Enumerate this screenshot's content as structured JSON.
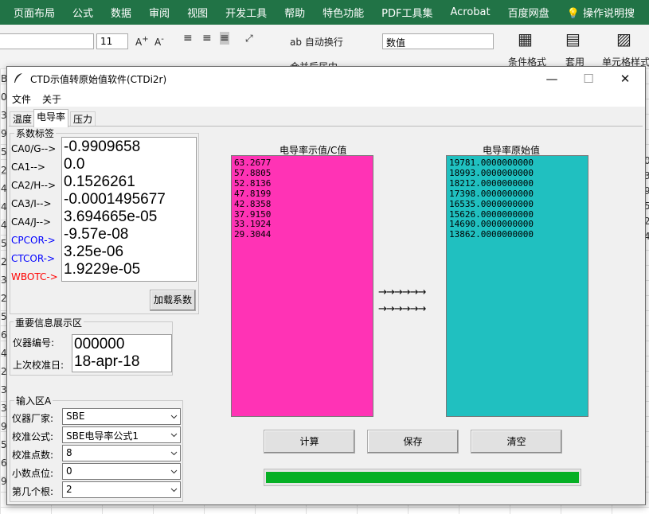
{
  "excel": {
    "menu": [
      "页面布局",
      "公式",
      "数据",
      "审阅",
      "视图",
      "开发工具",
      "帮助",
      "特色功能",
      "PDF工具集",
      "Acrobat",
      "百度网盘",
      "操作说明搜"
    ],
    "font_size": "11",
    "wrap_text": "自动换行",
    "number_format": "数值",
    "cond_format": "条件格式",
    "apply_table": "套用",
    "cell_style": "单元格样式",
    "merge_center": "合并后居中",
    "row_fragments": [
      "B",
      "0",
      "3",
      "9",
      "5",
      "2",
      "4",
      "4",
      "4",
      "5",
      "2",
      "3",
      "2",
      "5",
      "6",
      "4",
      "2",
      "3",
      "3",
      "9",
      "5",
      "6",
      "9"
    ],
    "right_fragments": [
      "0",
      "3",
      "9",
      "5",
      "2",
      "4"
    ]
  },
  "window": {
    "title": "CTD示值转原始值软件(CTDi2r)",
    "minimize": "—",
    "maximize": "☐",
    "close": "✕",
    "menu_file": "文件",
    "menu_about": "关于",
    "tabs": [
      "温度",
      "电导率",
      "压力"
    ]
  },
  "coef_group": {
    "title": "系数标签",
    "labels": [
      "CA0/G-->",
      "CA1-->",
      "CA2/H-->",
      "CA3/I-->",
      "CA4/J-->",
      "CPCOR->",
      "CTCOR->",
      "WBOTC->"
    ],
    "label_colors": [
      "#000000",
      "#000000",
      "#000000",
      "#000000",
      "#000000",
      "#0000ff",
      "#0000ff",
      "#ff0000"
    ],
    "values": [
      "-0.9909658",
      "0.0",
      "0.1526261",
      "-0.0001495677",
      "3.694665e-05",
      "-9.57e-08",
      "3.25e-06",
      "1.9229e-05"
    ],
    "load_button": "加载系数"
  },
  "info_group": {
    "title": "重要信息展示区",
    "serial_label": "仪器编号:",
    "serial_value": "000000",
    "calib_label": "上次校准日:",
    "calib_value": "18-apr-18"
  },
  "input_group": {
    "title": "输入区A",
    "fields": [
      {
        "label": "仪器厂家:",
        "value": "SBE"
      },
      {
        "label": "校准公式:",
        "value": "SBE电导率公式1"
      },
      {
        "label": "校准点数:",
        "value": "8"
      },
      {
        "label": "小数点位:",
        "value": "0"
      },
      {
        "label": "第几个根:",
        "value": "2"
      }
    ]
  },
  "left_panel": {
    "title": "电导率示值/C值",
    "color": "#ff33b5",
    "text": "63.2677\n57.8805\n52.8136\n47.8199\n42.8358\n37.9150\n33.1924\n29.3044"
  },
  "right_panel": {
    "title": "电导率原始值",
    "color": "#20c0c0",
    "text": "19781.0000000000\n18993.0000000000\n18212.0000000000\n17398.0000000000\n16535.0000000000\n15626.0000000000\n14690.0000000000\n13862.0000000000"
  },
  "arrows": "→→→→→→",
  "buttons": {
    "calc": "计算",
    "save": "保存",
    "clear": "清空"
  },
  "progress": {
    "value": 1.0,
    "color": "#06b025"
  }
}
